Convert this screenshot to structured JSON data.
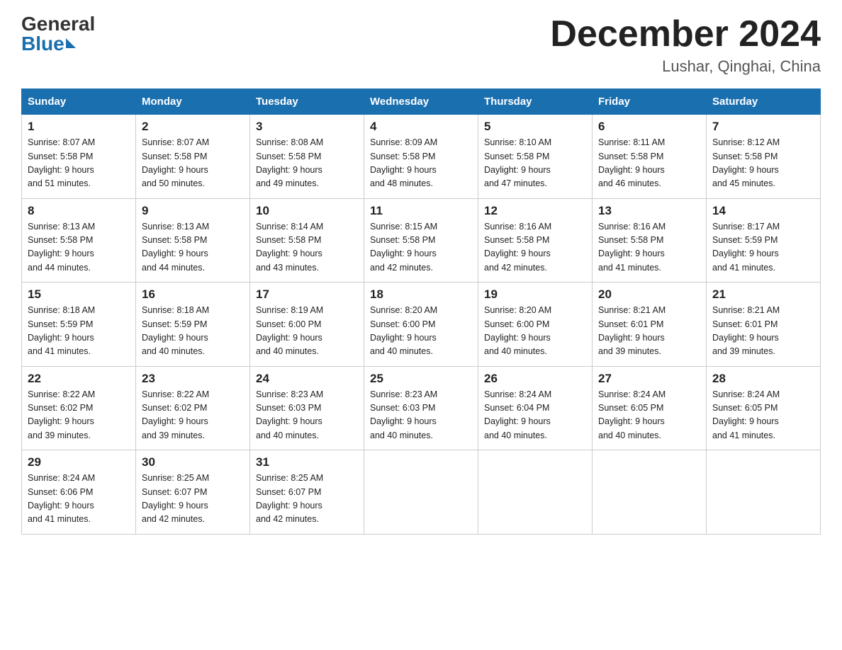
{
  "logo": {
    "general": "General",
    "blue": "Blue"
  },
  "title": {
    "month": "December 2024",
    "location": "Lushar, Qinghai, China"
  },
  "weekdays": [
    "Sunday",
    "Monday",
    "Tuesday",
    "Wednesday",
    "Thursday",
    "Friday",
    "Saturday"
  ],
  "weeks": [
    [
      {
        "day": "1",
        "sunrise": "8:07 AM",
        "sunset": "5:58 PM",
        "daylight": "9 hours and 51 minutes."
      },
      {
        "day": "2",
        "sunrise": "8:07 AM",
        "sunset": "5:58 PM",
        "daylight": "9 hours and 50 minutes."
      },
      {
        "day": "3",
        "sunrise": "8:08 AM",
        "sunset": "5:58 PM",
        "daylight": "9 hours and 49 minutes."
      },
      {
        "day": "4",
        "sunrise": "8:09 AM",
        "sunset": "5:58 PM",
        "daylight": "9 hours and 48 minutes."
      },
      {
        "day": "5",
        "sunrise": "8:10 AM",
        "sunset": "5:58 PM",
        "daylight": "9 hours and 47 minutes."
      },
      {
        "day": "6",
        "sunrise": "8:11 AM",
        "sunset": "5:58 PM",
        "daylight": "9 hours and 46 minutes."
      },
      {
        "day": "7",
        "sunrise": "8:12 AM",
        "sunset": "5:58 PM",
        "daylight": "9 hours and 45 minutes."
      }
    ],
    [
      {
        "day": "8",
        "sunrise": "8:13 AM",
        "sunset": "5:58 PM",
        "daylight": "9 hours and 44 minutes."
      },
      {
        "day": "9",
        "sunrise": "8:13 AM",
        "sunset": "5:58 PM",
        "daylight": "9 hours and 44 minutes."
      },
      {
        "day": "10",
        "sunrise": "8:14 AM",
        "sunset": "5:58 PM",
        "daylight": "9 hours and 43 minutes."
      },
      {
        "day": "11",
        "sunrise": "8:15 AM",
        "sunset": "5:58 PM",
        "daylight": "9 hours and 42 minutes."
      },
      {
        "day": "12",
        "sunrise": "8:16 AM",
        "sunset": "5:58 PM",
        "daylight": "9 hours and 42 minutes."
      },
      {
        "day": "13",
        "sunrise": "8:16 AM",
        "sunset": "5:58 PM",
        "daylight": "9 hours and 41 minutes."
      },
      {
        "day": "14",
        "sunrise": "8:17 AM",
        "sunset": "5:59 PM",
        "daylight": "9 hours and 41 minutes."
      }
    ],
    [
      {
        "day": "15",
        "sunrise": "8:18 AM",
        "sunset": "5:59 PM",
        "daylight": "9 hours and 41 minutes."
      },
      {
        "day": "16",
        "sunrise": "8:18 AM",
        "sunset": "5:59 PM",
        "daylight": "9 hours and 40 minutes."
      },
      {
        "day": "17",
        "sunrise": "8:19 AM",
        "sunset": "6:00 PM",
        "daylight": "9 hours and 40 minutes."
      },
      {
        "day": "18",
        "sunrise": "8:20 AM",
        "sunset": "6:00 PM",
        "daylight": "9 hours and 40 minutes."
      },
      {
        "day": "19",
        "sunrise": "8:20 AM",
        "sunset": "6:00 PM",
        "daylight": "9 hours and 40 minutes."
      },
      {
        "day": "20",
        "sunrise": "8:21 AM",
        "sunset": "6:01 PM",
        "daylight": "9 hours and 39 minutes."
      },
      {
        "day": "21",
        "sunrise": "8:21 AM",
        "sunset": "6:01 PM",
        "daylight": "9 hours and 39 minutes."
      }
    ],
    [
      {
        "day": "22",
        "sunrise": "8:22 AM",
        "sunset": "6:02 PM",
        "daylight": "9 hours and 39 minutes."
      },
      {
        "day": "23",
        "sunrise": "8:22 AM",
        "sunset": "6:02 PM",
        "daylight": "9 hours and 39 minutes."
      },
      {
        "day": "24",
        "sunrise": "8:23 AM",
        "sunset": "6:03 PM",
        "daylight": "9 hours and 40 minutes."
      },
      {
        "day": "25",
        "sunrise": "8:23 AM",
        "sunset": "6:03 PM",
        "daylight": "9 hours and 40 minutes."
      },
      {
        "day": "26",
        "sunrise": "8:24 AM",
        "sunset": "6:04 PM",
        "daylight": "9 hours and 40 minutes."
      },
      {
        "day": "27",
        "sunrise": "8:24 AM",
        "sunset": "6:05 PM",
        "daylight": "9 hours and 40 minutes."
      },
      {
        "day": "28",
        "sunrise": "8:24 AM",
        "sunset": "6:05 PM",
        "daylight": "9 hours and 41 minutes."
      }
    ],
    [
      {
        "day": "29",
        "sunrise": "8:24 AM",
        "sunset": "6:06 PM",
        "daylight": "9 hours and 41 minutes."
      },
      {
        "day": "30",
        "sunrise": "8:25 AM",
        "sunset": "6:07 PM",
        "daylight": "9 hours and 42 minutes."
      },
      {
        "day": "31",
        "sunrise": "8:25 AM",
        "sunset": "6:07 PM",
        "daylight": "9 hours and 42 minutes."
      },
      null,
      null,
      null,
      null
    ]
  ],
  "labels": {
    "sunrise": "Sunrise:",
    "sunset": "Sunset:",
    "daylight": "Daylight:"
  }
}
